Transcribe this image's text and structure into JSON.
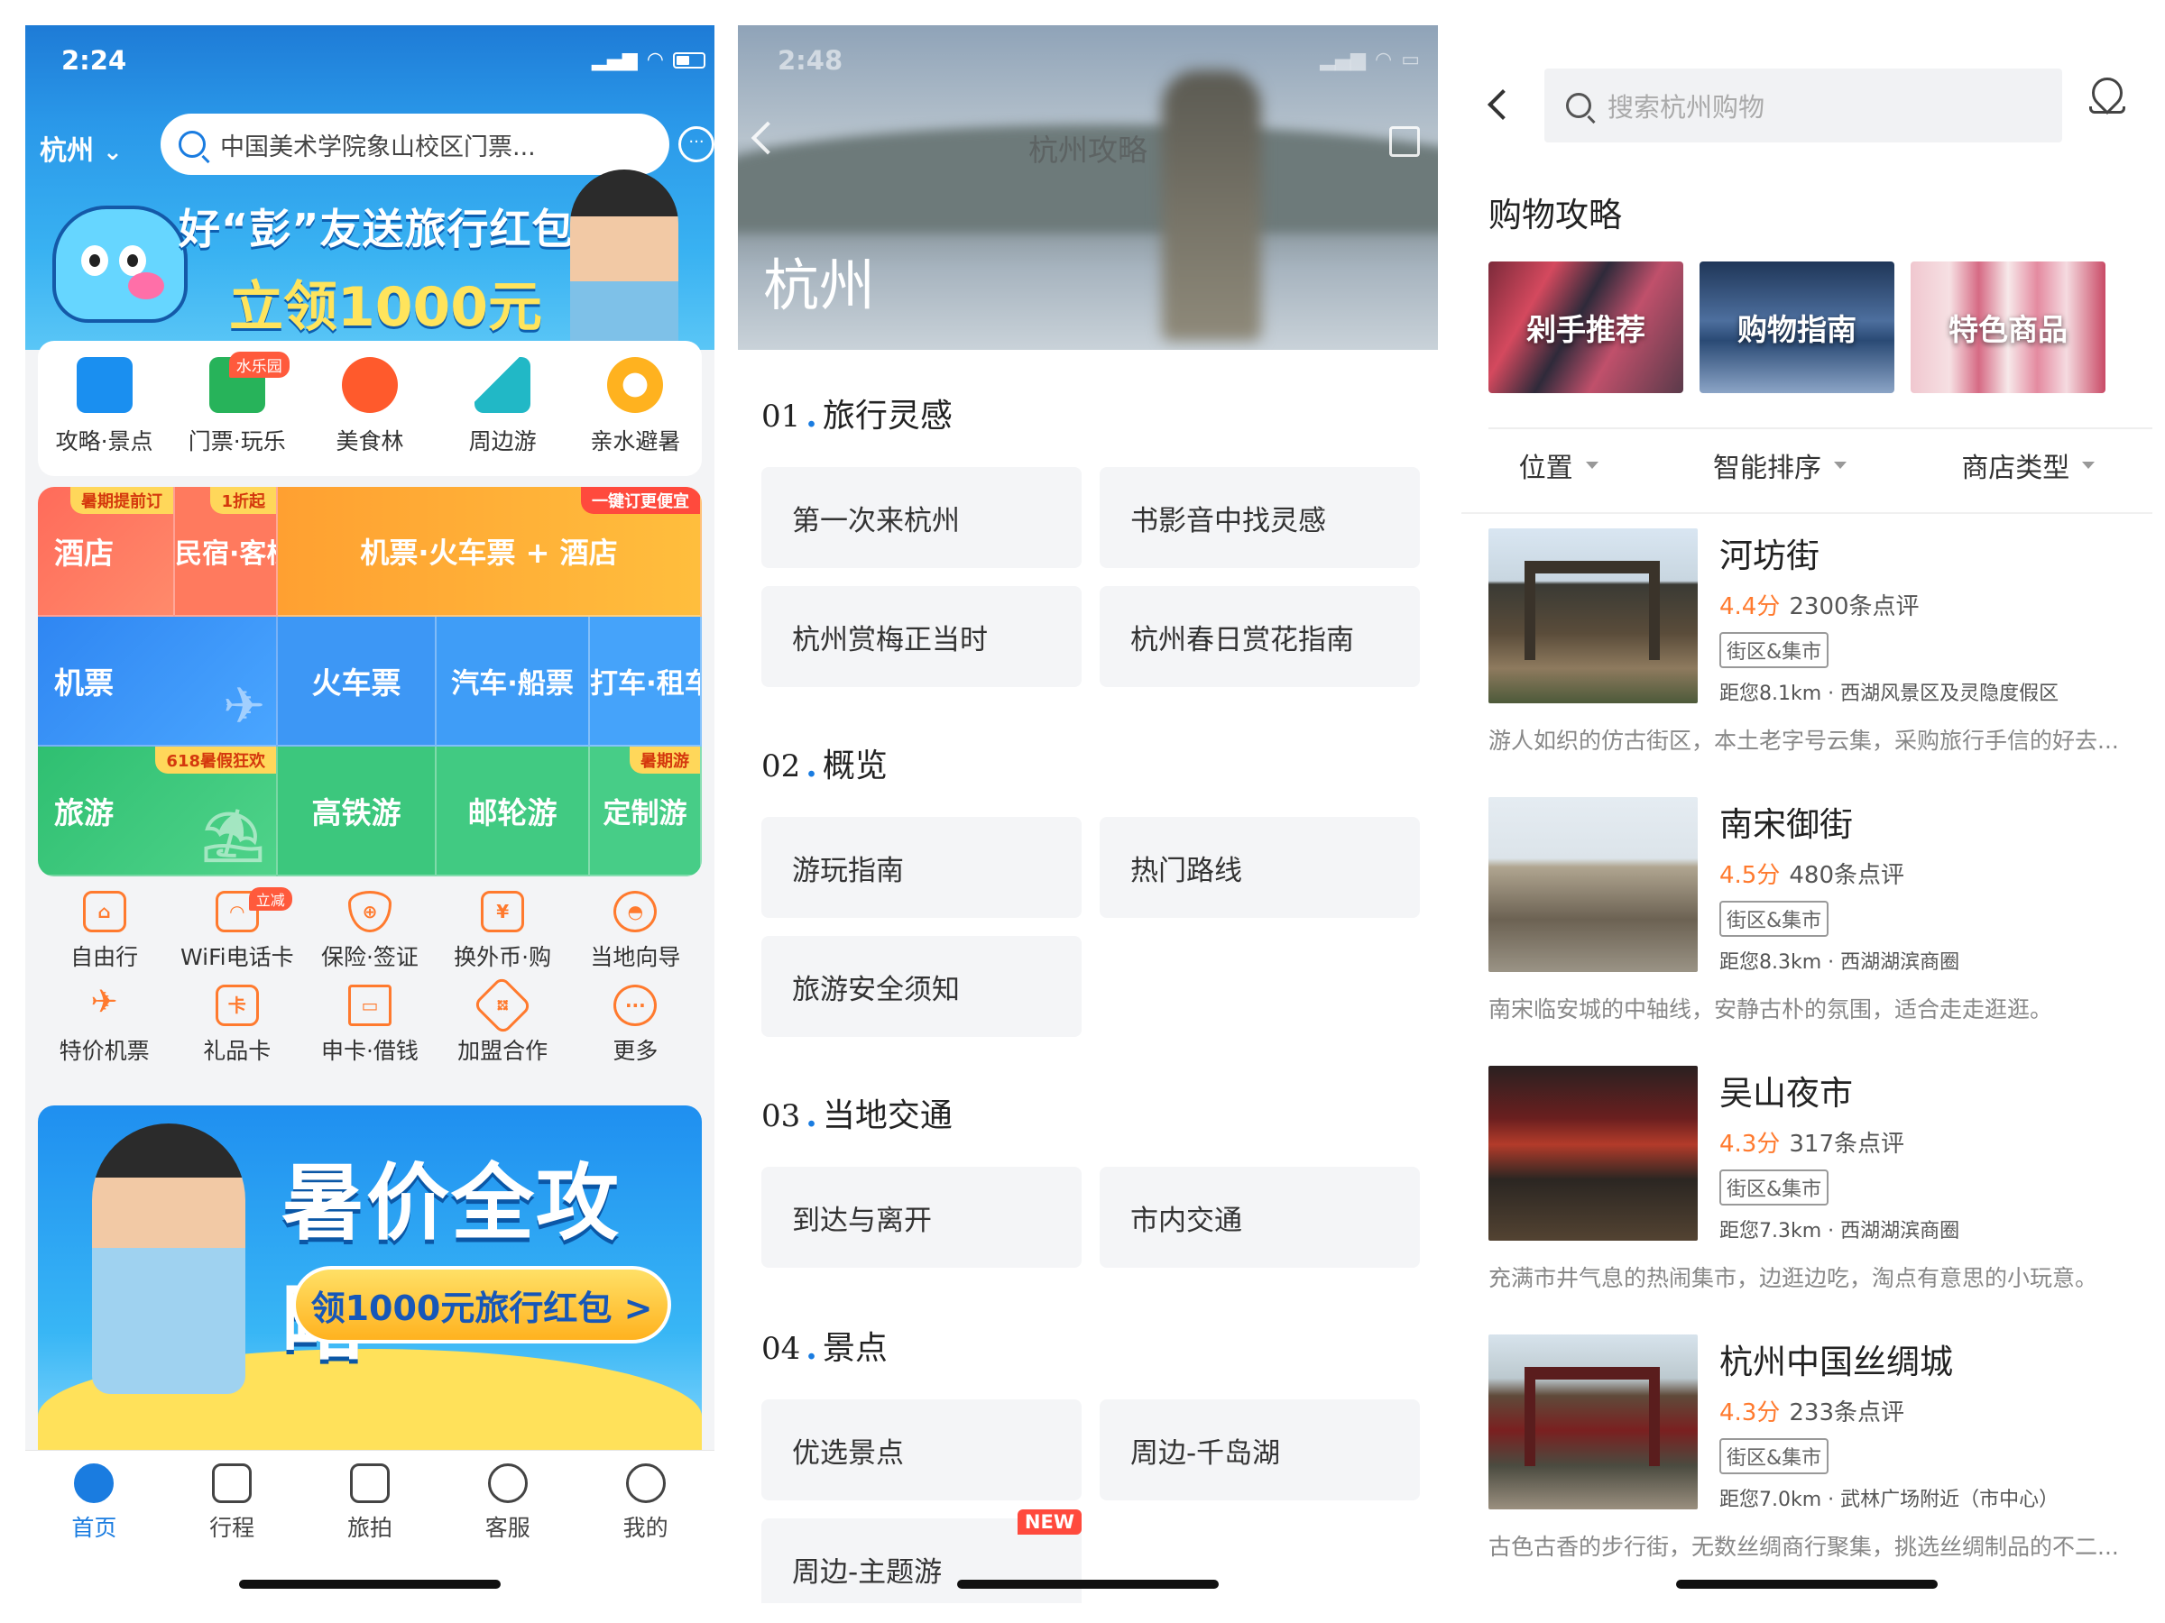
{
  "screen1": {
    "status_time": "2:24",
    "city": "杭州",
    "search_placeholder": "中国美术学院象山校区门票...",
    "promo_line1": "好“彭”友送旅行红包",
    "promo_line2": "立领1000元",
    "quick_entries": [
      {
        "label": "攻略·景点",
        "icon": "map-guide-icon",
        "color": "#1a8ff0"
      },
      {
        "label": "门票·玩乐",
        "icon": "ticket-icon",
        "color": "#27b35a",
        "badge": "水乐园"
      },
      {
        "label": "美食林",
        "icon": "food-icon",
        "color": "#ff5a2c"
      },
      {
        "label": "周边游",
        "icon": "mountain-icon",
        "color": "#21b8c6"
      },
      {
        "label": "亲水避暑",
        "icon": "swim-ring-icon",
        "color": "#ffb21f"
      }
    ],
    "grid": {
      "hotel": {
        "label": "酒店",
        "tag": "暑期提前订"
      },
      "inn": {
        "label": "民宿·客栈",
        "tag": "1折起"
      },
      "bundle": {
        "label": "机票·火车票 + 酒店",
        "tag": "一键订更便宜"
      },
      "flight": {
        "label": "机票"
      },
      "train": {
        "label": "火车票"
      },
      "bus": {
        "label": "汽车·船票"
      },
      "taxi": {
        "label": "打车·租车"
      },
      "tour": {
        "label": "旅游",
        "tag": "618暑假狂欢"
      },
      "rail_tour": {
        "label": "高铁游"
      },
      "cruise": {
        "label": "邮轮游"
      },
      "custom": {
        "label": "定制游",
        "tag": "暑期游"
      }
    },
    "services_row1": [
      {
        "label": "自由行",
        "icon": "backpack-icon"
      },
      {
        "label": "WiFi电话卡",
        "icon": "wifi-icon",
        "badge": "立减"
      },
      {
        "label": "保险·签证",
        "icon": "shield-icon"
      },
      {
        "label": "换外币·购",
        "icon": "currency-icon"
      },
      {
        "label": "当地向导",
        "icon": "guide-hat-icon"
      }
    ],
    "services_row2": [
      {
        "label": "特价机票",
        "icon": "plane-icon"
      },
      {
        "label": "礼品卡",
        "icon": "gift-card-icon"
      },
      {
        "label": "申卡·借钱",
        "icon": "credit-card-icon"
      },
      {
        "label": "加盟合作",
        "icon": "handshake-icon"
      },
      {
        "label": "更多",
        "icon": "more-icon"
      }
    ],
    "banner_title": "暑价全攻略",
    "banner_button": "领1000元旅行红包 >",
    "tabs": [
      {
        "label": "首页",
        "icon": "home-icon",
        "active": true
      },
      {
        "label": "行程",
        "icon": "calendar-icon"
      },
      {
        "label": "旅拍",
        "icon": "camera-icon"
      },
      {
        "label": "客服",
        "icon": "service-icon"
      },
      {
        "label": "我的",
        "icon": "profile-icon"
      }
    ]
  },
  "screen2": {
    "status_time": "2:48",
    "nav_title": "杭州攻略",
    "city": "杭州",
    "sections": [
      {
        "num": "01",
        "title": "旅行灵感",
        "items": [
          "第一次来杭州",
          "书影音中找灵感",
          "杭州赏梅正当时",
          "杭州春日赏花指南"
        ]
      },
      {
        "num": "02",
        "title": "概览",
        "items": [
          "游玩指南",
          "热门路线",
          "旅游安全须知"
        ]
      },
      {
        "num": "03",
        "title": "当地交通",
        "items": [
          "到达与离开",
          "市内交通"
        ]
      },
      {
        "num": "04",
        "title": "景点",
        "items": [
          "优选景点",
          "周边-千岛湖",
          "周边-主题游"
        ],
        "new_badge": "NEW"
      }
    ]
  },
  "screen3": {
    "search_placeholder": "搜索杭州购物",
    "guide_title": "购物攻略",
    "guides": [
      "剁手推荐",
      "购物指南",
      "特色商品"
    ],
    "filters": [
      "位置",
      "智能排序",
      "商店类型"
    ],
    "shops": [
      {
        "name": "河坊街",
        "score": "4.4分",
        "reviews": "2300条点评",
        "category": "街区&集市",
        "distance": "距您8.1km · 西湖风景区及灵隐度假区",
        "desc": "游人如织的仿古街区，本土老字号云集，采购旅行手信的好去..."
      },
      {
        "name": "南宋御街",
        "score": "4.5分",
        "reviews": "480条点评",
        "category": "街区&集市",
        "distance": "距您8.3km · 西湖湖滨商圈",
        "desc": "南宋临安城的中轴线，安静古朴的氛围，适合走走逛逛。"
      },
      {
        "name": "吴山夜市",
        "score": "4.3分",
        "reviews": "317条点评",
        "category": "街区&集市",
        "distance": "距您7.3km · 西湖湖滨商圈",
        "desc": "充满市井气息的热闹集市，边逛边吃，淘点有意思的小玩意。"
      },
      {
        "name": "杭州中国丝绸城",
        "score": "4.3分",
        "reviews": "233条点评",
        "category": "街区&集市",
        "distance": "距您7.0km · 武林广场附近（市中心）",
        "desc": "古色古香的步行街，无数丝绸商行聚集，挑选丝绸制品的不二..."
      }
    ]
  },
  "colors": {
    "accent_blue": "#1a7ce0",
    "accent_orange": "#ff7a2e",
    "badge_red": "#ff4a3d"
  }
}
